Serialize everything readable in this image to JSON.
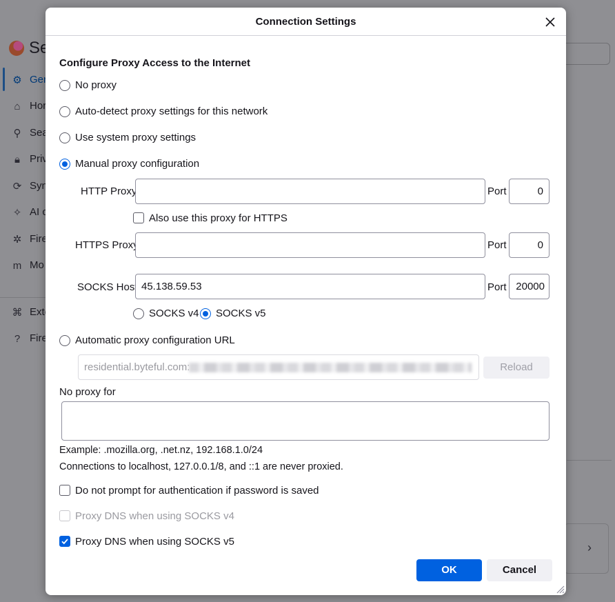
{
  "background": {
    "title": "Se",
    "nav": [
      {
        "icon": "gear-icon",
        "glyph": "⚙",
        "label": "Gen"
      },
      {
        "icon": "home-icon",
        "glyph": "⌂",
        "label": "Hor"
      },
      {
        "icon": "search-icon",
        "glyph": "⚲",
        "label": "Sea"
      },
      {
        "icon": "lock-icon",
        "glyph": "🔒︎",
        "label": "Priv"
      },
      {
        "icon": "sync-icon",
        "glyph": "⟳",
        "label": "Syn"
      },
      {
        "icon": "ai-sparkle-icon",
        "glyph": "✧",
        "label": "AI c"
      },
      {
        "icon": "firefox-labs-icon",
        "glyph": "✲",
        "label": "Fire"
      },
      {
        "icon": "mozilla-icon",
        "glyph": "m",
        "label": "Mo"
      },
      {
        "icon": "extensions-icon",
        "glyph": "⌘",
        "label": "Exte"
      },
      {
        "icon": "help-icon",
        "glyph": "?",
        "label": "Fire"
      }
    ],
    "card_chevron": "›"
  },
  "dialog": {
    "title": "Connection Settings",
    "section_title": "Configure Proxy Access to the Internet",
    "options": {
      "no_proxy": "No proxy",
      "auto_detect": "Auto-detect proxy settings for this network",
      "system": "Use system proxy settings",
      "manual": "Manual proxy configuration",
      "auto_url": "Automatic proxy configuration URL"
    },
    "selected_option": "manual",
    "http_proxy": {
      "label": "HTTP Proxy",
      "value": "",
      "port_label": "Port",
      "port": "0"
    },
    "also_https": {
      "label": "Also use this proxy for HTTPS",
      "checked": false
    },
    "https_proxy": {
      "label": "HTTPS Proxy",
      "value": "",
      "port_label": "Port",
      "port": "0"
    },
    "socks_host": {
      "label": "SOCKS Host",
      "value": "45.138.59.53",
      "port_label": "Port",
      "port": "20000"
    },
    "socks_version": {
      "v4": "SOCKS v4",
      "v5": "SOCKS v5",
      "selected": "v5"
    },
    "auto_url_value": "residential.byteful.com:",
    "reload_label": "Reload",
    "no_proxy_for": {
      "label": "No proxy for",
      "value": ""
    },
    "example_text": "Example: .mozilla.org, .net.nz, 192.168.1.0/24",
    "localhost_note": "Connections to localhost, 127.0.0.1/8, and ::1 are never proxied.",
    "no_prompt_auth": {
      "label": "Do not prompt for authentication if password is saved",
      "checked": false
    },
    "dns_socks4": {
      "label": "Proxy DNS when using SOCKS v4",
      "checked": false,
      "disabled": true
    },
    "dns_socks5": {
      "label": "Proxy DNS when using SOCKS v5",
      "checked": true
    },
    "ok_label": "OK",
    "cancel_label": "Cancel"
  }
}
